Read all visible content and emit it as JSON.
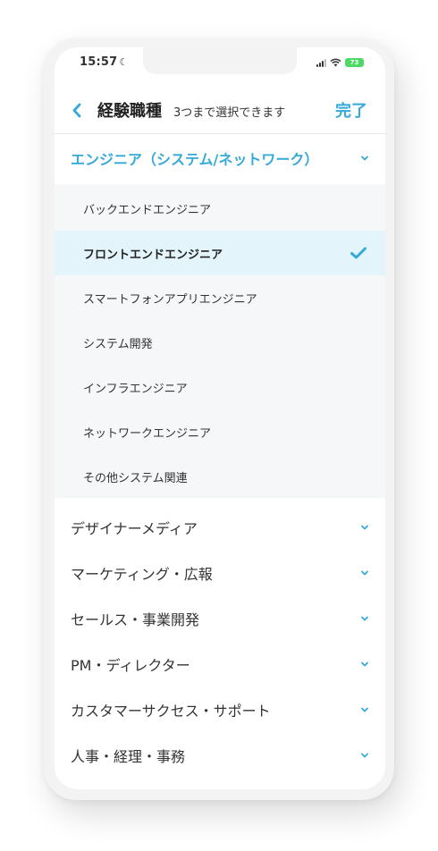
{
  "status_bar": {
    "time": "15:57",
    "battery": "73"
  },
  "header": {
    "title": "経験職種",
    "subtitle": "3つまで選択できます",
    "done_label": "完了"
  },
  "accent_color": "#35a9d8",
  "expanded_group": {
    "label": "エンジニア（システム/ネットワーク）",
    "items": [
      {
        "label": "バックエンドエンジニア",
        "selected": false
      },
      {
        "label": "フロントエンドエンジニア",
        "selected": true
      },
      {
        "label": "スマートフォンアプリエンジニア",
        "selected": false
      },
      {
        "label": "システム開発",
        "selected": false
      },
      {
        "label": "インフラエンジニア",
        "selected": false
      },
      {
        "label": "ネットワークエンジニア",
        "selected": false
      },
      {
        "label": "その他システム関連",
        "selected": false
      }
    ]
  },
  "groups": [
    {
      "label": "デザイナーメディア"
    },
    {
      "label": "マーケティング・広報"
    },
    {
      "label": "セールス・事業開発"
    },
    {
      "label": "PM・ディレクター"
    },
    {
      "label": "カスタマーサクセス・サポート"
    },
    {
      "label": "人事・経理・事務"
    }
  ]
}
